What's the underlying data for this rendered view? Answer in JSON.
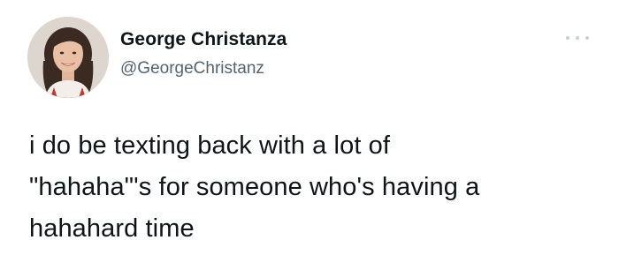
{
  "author": {
    "display_name": "George Christanza",
    "handle": "@GeorgeChristanz",
    "avatar_icon": "profile-photo"
  },
  "menu": {
    "icon": "more-options-icon"
  },
  "tweet": {
    "text": "i do be texting back with a lot of\n\"hahaha\"'s for someone who's having a\nhahahard time"
  },
  "colors": {
    "text_primary": "#0f1419",
    "text_secondary": "#536471",
    "background": "#ffffff"
  }
}
